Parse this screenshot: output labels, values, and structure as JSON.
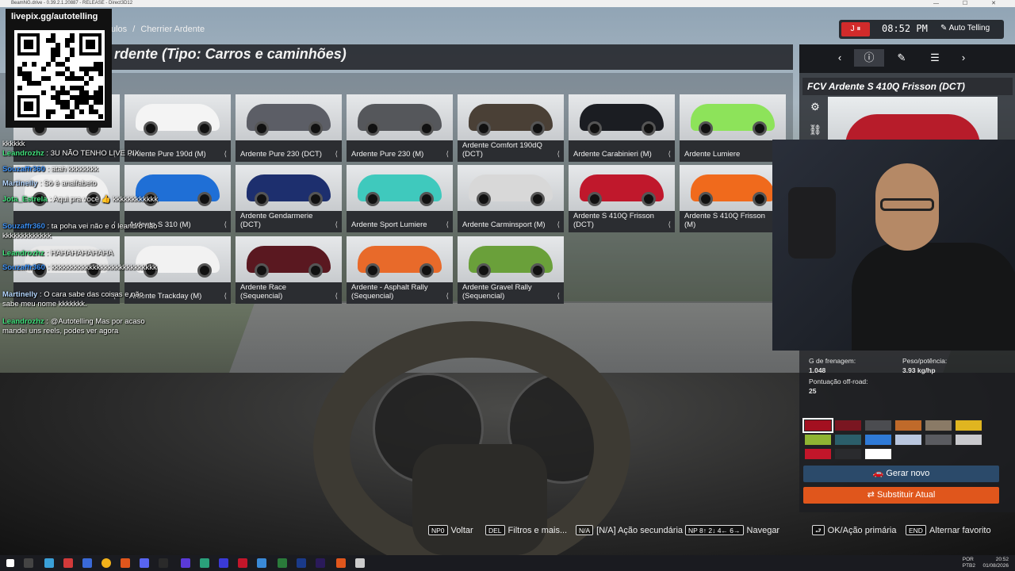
{
  "window": {
    "title": "BeamNG.drive - 0.39.2.1.20887 - RELEASE - Direct3D12",
    "controls": "— ☐ ✕"
  },
  "breadcrumb": {
    "prev": "ulos",
    "sep": "/",
    "current": "Cherrier Ardente"
  },
  "header": {
    "title": "rdente (Tipo: Carros e caminhões)"
  },
  "top_right": {
    "rec_label": "J ⏸",
    "time": "08:52 PM",
    "user": "Auto Telling"
  },
  "qr": {
    "url": "livepix.gg/autotelling"
  },
  "vehicles": [
    {
      "label": ""
    },
    {
      "label": "Ardente Pure 190d (M)"
    },
    {
      "label": "Ardente Pure 230 (DCT)"
    },
    {
      "label": "Ardente Pure 230 (M)"
    },
    {
      "label": "Ardente Comfort 190dQ (DCT)"
    },
    {
      "label": "Ardente Carabinieri (M)"
    },
    {
      "label": "Ardente Lumiere"
    },
    {
      "label": ""
    },
    {
      "label": "Ardente S 310 (M)"
    },
    {
      "label": "Ardente Gendarmerie (DCT)"
    },
    {
      "label": "Ardente Sport Lumiere"
    },
    {
      "label": "Ardente Carminsport (M)"
    },
    {
      "label": "Ardente S 410Q Frisson (DCT)"
    },
    {
      "label": "Ardente S 410Q Frisson (M)"
    },
    {
      "label": ""
    },
    {
      "label": "Ardente Trackday (M)"
    },
    {
      "label": "Ardente Race (Sequencial)"
    },
    {
      "label": "Ardente - Asphalt Rally (Sequencial)"
    },
    {
      "label": "Ardente Gravel Rally (Sequencial)"
    }
  ],
  "vehicle_colors": [
    "#cfd2d5",
    "#f4f4f4",
    "#5c5e66",
    "#55575b",
    "#4a4036",
    "#1b1d22",
    "#8de35a",
    "#f0f0f0",
    "#1f6fd6",
    "#1d2f6e",
    "#3fc9bd",
    "#d8d8d8",
    "#c0182c",
    "#f06a1c",
    "#e8e8e8",
    "#f2f2f2",
    "#5a1820",
    "#e86a2a",
    "#6aa03a"
  ],
  "details": {
    "car_title": "FCV Ardente S 410Q Frisson (DCT)",
    "stats": [
      {
        "label": "G de frenagem:",
        "value": "1.048"
      },
      {
        "label": "Peso/potência:",
        "value": "3.93 kg/hp"
      },
      {
        "label": "Pontuação off-road:",
        "value": "25"
      }
    ],
    "swatches": [
      "#a31020",
      "#7a1621",
      "#4b4c50",
      "#c06a2a",
      "#8a7a66",
      "#e0b520",
      "#8fb533",
      "#2b5e6a",
      "#2f7ad6",
      "#b9c6de",
      "#5a5b60",
      "#c9c9cd",
      "#c2162a",
      "#2a2b2e",
      "#ffffff"
    ],
    "generate_label": "Gerar novo",
    "replace_label": "Substituir Atual"
  },
  "chat": [
    {
      "user": "",
      "text": "kkkkkk",
      "cls": "u1"
    },
    {
      "user": "Leandrozhz",
      "text": ": 3U NÃO TENHO LIVE PIX",
      "cls": "u1"
    },
    {
      "user": "Souzaffr360",
      "text": ": atah kkkkkkkk",
      "cls": "u2"
    },
    {
      "user": "Martinelly",
      "text": ": Só é analfabeto",
      "cls": "u3"
    },
    {
      "user": "Jota_Estrela",
      "text": ": Aqui pra você 👍 kkkkkkkkkkkk",
      "cls": "u1"
    },
    {
      "user": "Souzaffr360",
      "text": ": ta poha vei não e o leandro não kkkkkkkkkkkkk",
      "cls": "u2"
    },
    {
      "user": "Leandrozhz",
      "text": ": HAHAHAHAHAHA",
      "cls": "u1"
    },
    {
      "user": "Souzaffr360",
      "text": ": kkkkkkkkkkkkkkkkkkkkkkkkkkkk",
      "cls": "u2"
    },
    {
      "user": "Martinelly",
      "text": ": O cara sabe das coisas e não sabe meu nome kkkkkkk.",
      "cls": "u3"
    },
    {
      "user": "Leandrozhz",
      "text": ": @Autotelling Mas por acaso mandei uns reels, podes ver agora",
      "cls": "u1"
    }
  ],
  "hints": [
    {
      "key": "NP0",
      "label": "Voltar"
    },
    {
      "key": "DEL",
      "label": "Filtros e mais..."
    },
    {
      "key": "N/A",
      "label": "[N/A] Ação secundária"
    },
    {
      "key": "NP 8↑ 2↓ 4← 6→",
      "label": "Navegar"
    },
    {
      "key": "⮐",
      "label": "OK/Ação primária"
    },
    {
      "key": "END",
      "label": "Alternar favorito"
    }
  ],
  "tray": {
    "lang1": "POR",
    "lang2": "PTB2",
    "time": "20:52",
    "date": "01/08/2026"
  }
}
